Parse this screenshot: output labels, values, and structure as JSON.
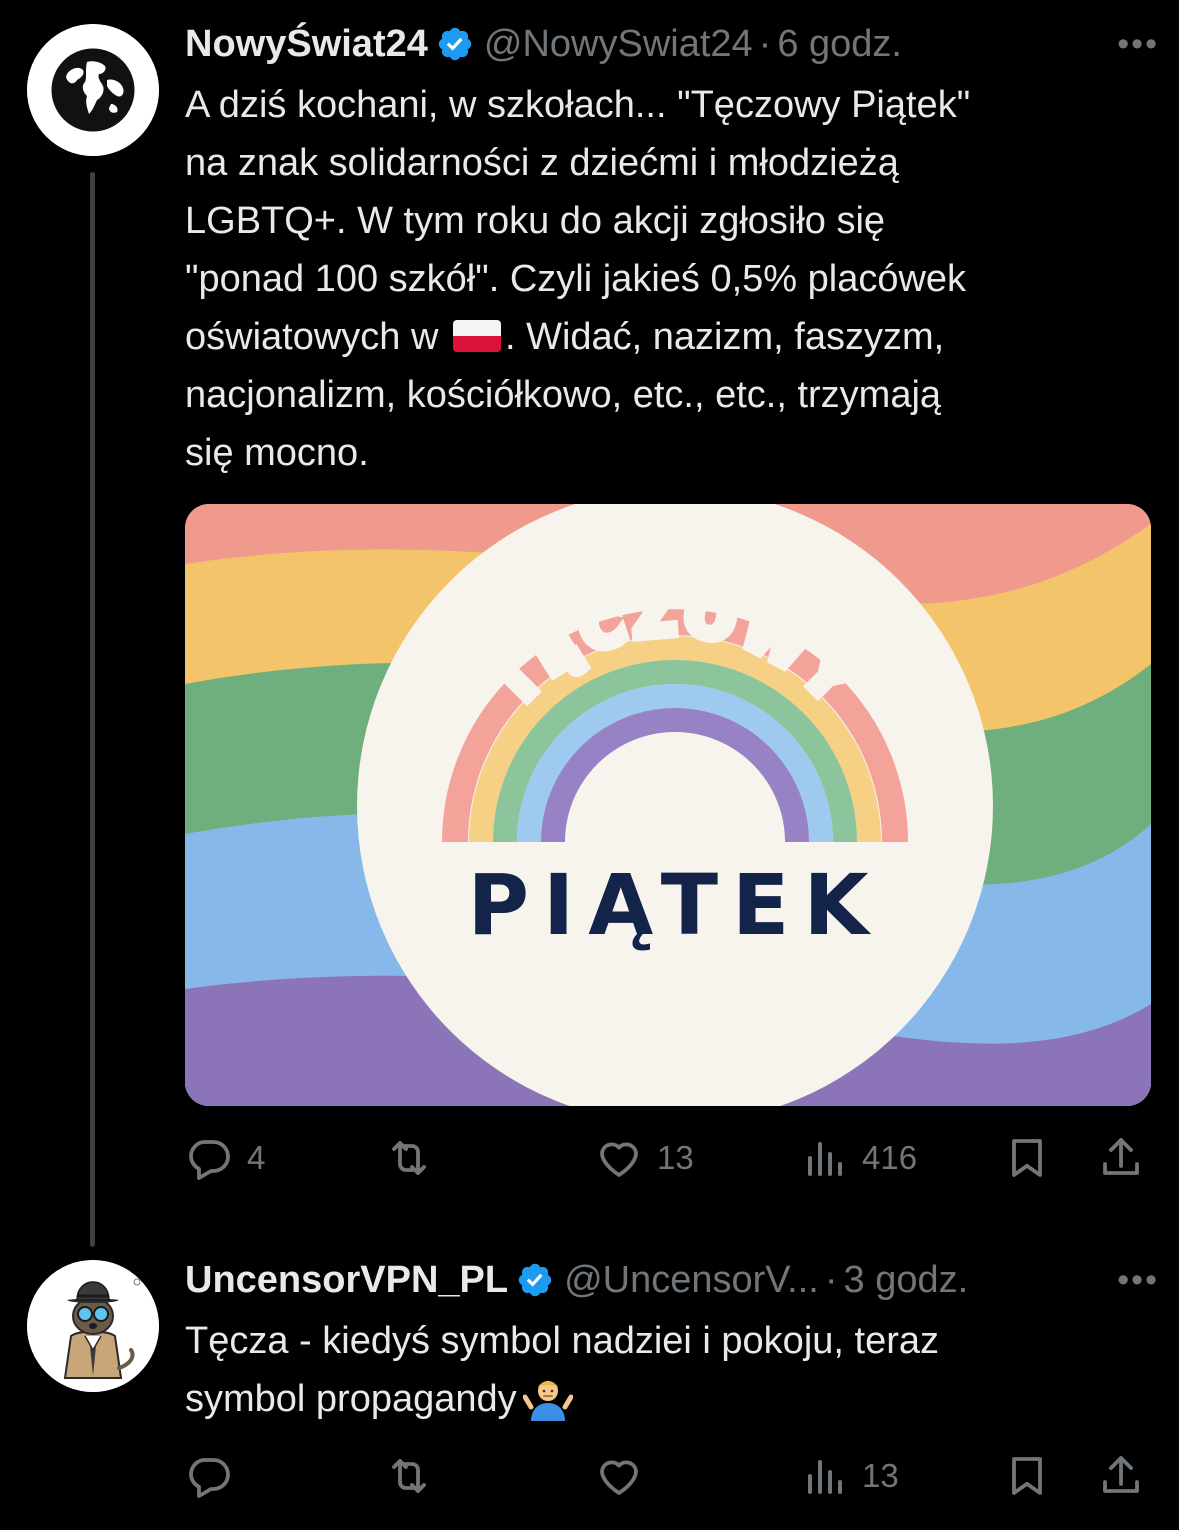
{
  "tweets": [
    {
      "display_name": "NowyŚwiat24",
      "handle": "@NowySwiat24",
      "separator": "·",
      "time": "6 godz.",
      "more": "•••",
      "body_lines": [
        "A dziś kochani, w szkołach... \"Tęczowy Piątek\"",
        "na znak solidarności z dziećmi i młodzieżą",
        "LGBTQ+. W tym roku do akcji zgłosiło się",
        "\"ponad 100 szkół\". Czyli jakieś 0,5% placówek"
      ],
      "body_flag_line_before": "oświatowych w",
      "body_flag_line_after": ". Widać, nazizm, faszyzm,",
      "body_lines_end": [
        "nacjonalizm, kościółkowo, etc., etc., trzymają",
        "się mocno."
      ],
      "media": {
        "logo_arc_text": "TĘCZOWY",
        "logo_word": "PIĄTEK",
        "stripe_colors": [
          "#f09a8e",
          "#f4c46b",
          "#6fae7d",
          "#87b8ea",
          "#8b74b7"
        ],
        "circle_color": "#f7f4ed",
        "logo_text_color": "#14234a"
      },
      "stats": {
        "replies": "4",
        "retweets": "",
        "likes": "13",
        "views": "416"
      }
    },
    {
      "display_name": "UncensorVPN_PL",
      "handle": "@UncensorV...",
      "separator": "·",
      "time": "3 godz.",
      "more": "•••",
      "body_lines": [
        "Tęcza - kiedyś symbol nadziei i pokoju, teraz"
      ],
      "body_last_line": "symbol propagandy",
      "stats": {
        "replies": "",
        "retweets": "",
        "likes": "",
        "views": "13"
      }
    }
  ],
  "colors": {
    "background": "#000000",
    "text": "#e7e9ea",
    "muted": "#71767b",
    "verified": "#1d9bf0",
    "thread_line": "#3e4144"
  },
  "icons": {
    "verified": "verified-badge-icon",
    "reply": "reply-icon",
    "retweet": "retweet-icon",
    "like": "heart-icon",
    "views": "views-icon",
    "bookmark": "bookmark-icon",
    "share": "share-icon"
  }
}
